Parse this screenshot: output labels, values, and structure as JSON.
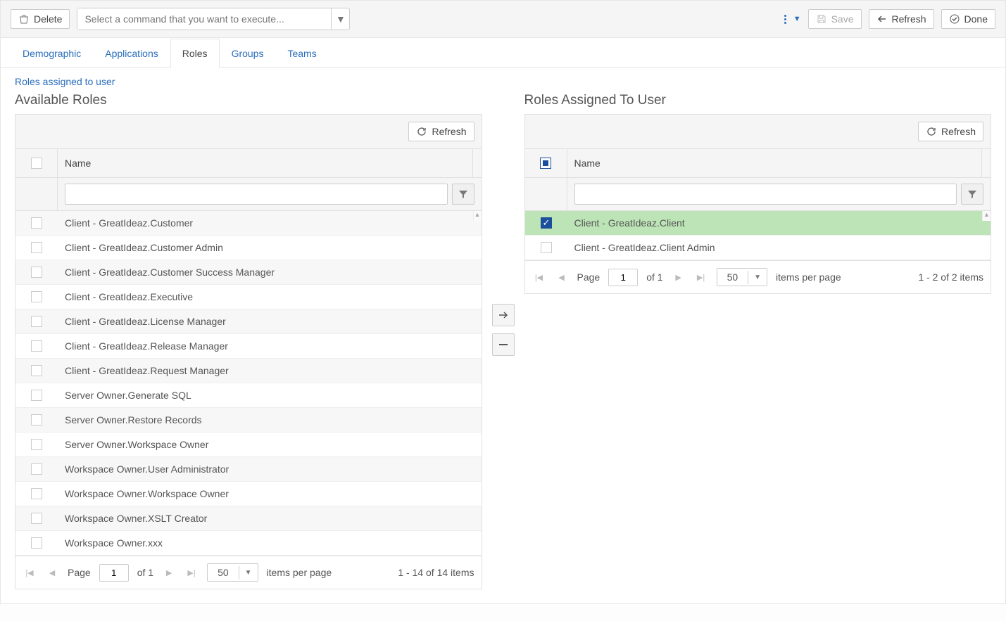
{
  "toolbar": {
    "delete_label": "Delete",
    "command_placeholder": "Select a command that you want to execute...",
    "save_label": "Save",
    "refresh_label": "Refresh",
    "done_label": "Done"
  },
  "tabs": [
    {
      "label": "Demographic",
      "active": false
    },
    {
      "label": "Applications",
      "active": false
    },
    {
      "label": "Roles",
      "active": true
    },
    {
      "label": "Groups",
      "active": false
    },
    {
      "label": "Teams",
      "active": false
    }
  ],
  "subnav": {
    "roles_assigned_link": "Roles assigned to user"
  },
  "available": {
    "title": "Available Roles",
    "refresh_label": "Refresh",
    "column_name": "Name",
    "rows": [
      {
        "name": "Client - GreatIdeaz.Customer"
      },
      {
        "name": "Client - GreatIdeaz.Customer Admin"
      },
      {
        "name": "Client - GreatIdeaz.Customer Success Manager"
      },
      {
        "name": "Client - GreatIdeaz.Executive"
      },
      {
        "name": "Client - GreatIdeaz.License Manager"
      },
      {
        "name": "Client - GreatIdeaz.Release Manager"
      },
      {
        "name": "Client - GreatIdeaz.Request Manager"
      },
      {
        "name": "Server Owner.Generate SQL"
      },
      {
        "name": "Server Owner.Restore Records"
      },
      {
        "name": "Server Owner.Workspace Owner"
      },
      {
        "name": "Workspace Owner.User Administrator"
      },
      {
        "name": "Workspace Owner.Workspace Owner"
      },
      {
        "name": "Workspace Owner.XSLT Creator"
      },
      {
        "name": "Workspace Owner.xxx"
      }
    ],
    "pager": {
      "page_label": "Page",
      "page_value": "1",
      "of_label": "of 1",
      "page_size": "50",
      "items_per_page": "items per page",
      "summary": "1 - 14 of 14 items"
    }
  },
  "assigned": {
    "title": "Roles Assigned To User",
    "refresh_label": "Refresh",
    "column_name": "Name",
    "rows": [
      {
        "name": "Client - GreatIdeaz.Client",
        "checked": true,
        "selected": true
      },
      {
        "name": "Client - GreatIdeaz.Client Admin",
        "checked": false,
        "selected": false
      }
    ],
    "pager": {
      "page_label": "Page",
      "page_value": "1",
      "of_label": "of 1",
      "page_size": "50",
      "items_per_page": "items per page",
      "summary": "1 - 2 of 2 items"
    }
  }
}
